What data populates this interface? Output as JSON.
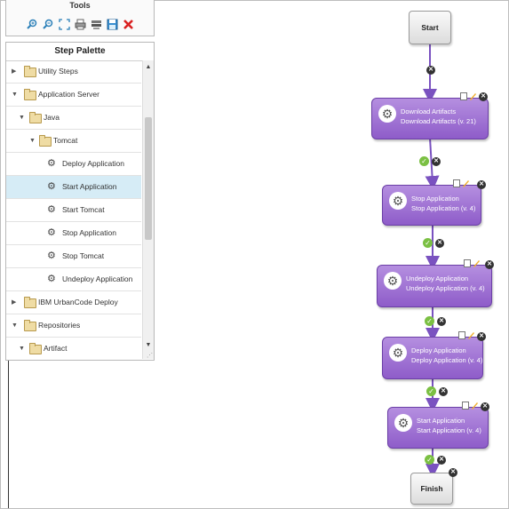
{
  "tools": {
    "title": "Tools",
    "icons": [
      "zoom-in-icon",
      "zoom-out-icon",
      "fit-screen-icon",
      "print-icon",
      "print-setup-icon",
      "save-icon",
      "delete-icon"
    ]
  },
  "palette": {
    "title": "Step Palette",
    "items": [
      {
        "label": "Utility Steps",
        "kind": "folder",
        "expanded": false
      },
      {
        "label": "Application Server",
        "kind": "folder",
        "expanded": true
      },
      {
        "label": "Java",
        "kind": "folder",
        "expanded": true
      },
      {
        "label": "Tomcat",
        "kind": "folder",
        "expanded": true
      },
      {
        "label": "Deploy Application",
        "kind": "step",
        "selected": false
      },
      {
        "label": "Start Application",
        "kind": "step",
        "selected": true
      },
      {
        "label": "Start Tomcat",
        "kind": "step",
        "selected": false
      },
      {
        "label": "Stop Application",
        "kind": "step",
        "selected": false
      },
      {
        "label": "Stop Tomcat",
        "kind": "step",
        "selected": false
      },
      {
        "label": "Undeploy Application",
        "kind": "step",
        "selected": false
      },
      {
        "label": "IBM UrbanCode Deploy",
        "kind": "folder",
        "expanded": false
      },
      {
        "label": "Repositories",
        "kind": "folder",
        "expanded": true
      },
      {
        "label": "Artifact",
        "kind": "folder",
        "expanded": true
      }
    ]
  },
  "flow": {
    "start": "Start",
    "finish": "Finish",
    "steps": [
      {
        "title": "Download Artifacts",
        "subtitle": "Download Artifacts (v. 21)"
      },
      {
        "title": "Stop Application",
        "subtitle": "Stop Application (v. 4)"
      },
      {
        "title": "Undeploy Application",
        "subtitle": "Undeploy Application (v. 4)"
      },
      {
        "title": "Deploy Application",
        "subtitle": "Deploy Application (v. 4)"
      },
      {
        "title": "Start Application",
        "subtitle": "Start Application (v. 4)"
      }
    ]
  },
  "colors": {
    "step_fill": "#9d6fd6",
    "connector": "#7a52c0",
    "success": "#7bc043",
    "selection": "#d6ecf6"
  }
}
